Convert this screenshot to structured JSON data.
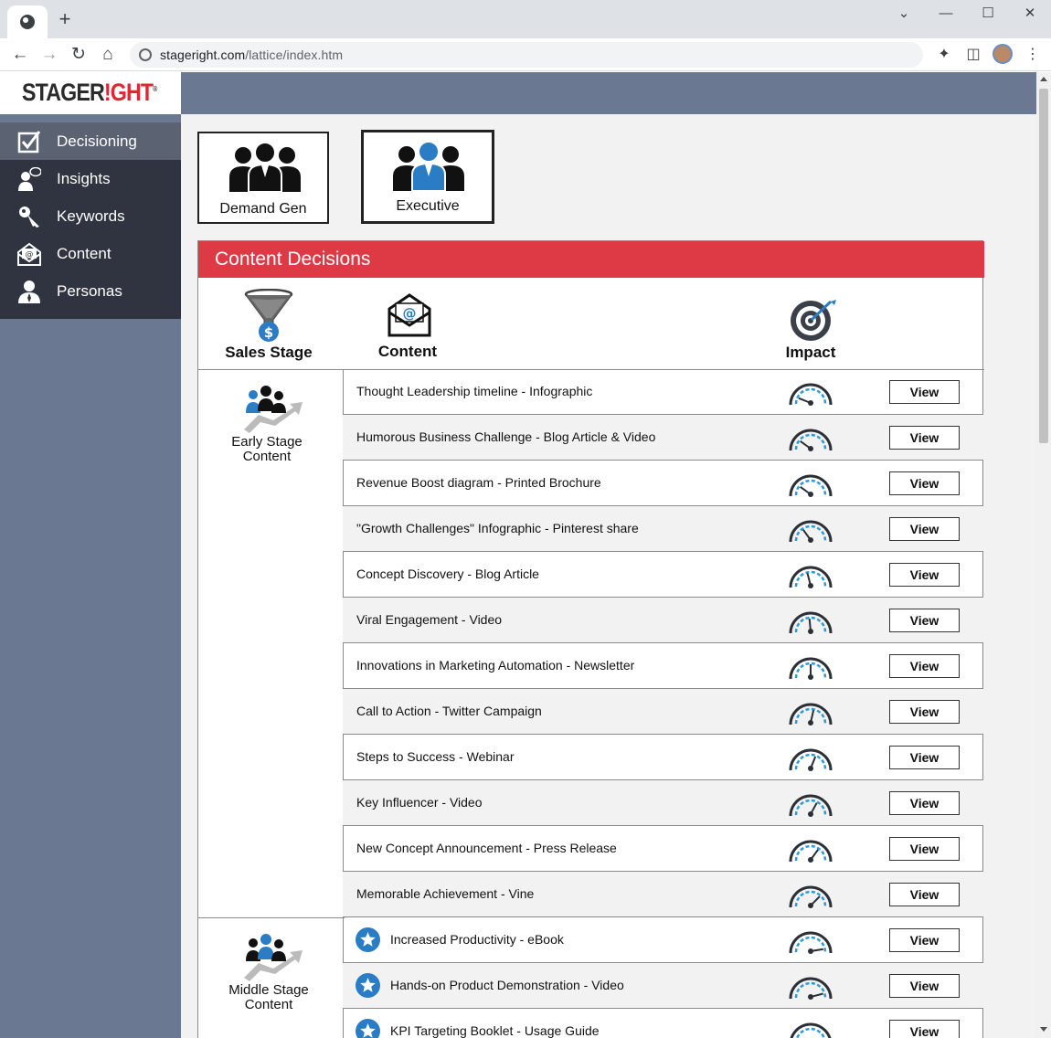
{
  "browser": {
    "url_host": "stageright.com",
    "url_path": "/lattice/index.htm"
  },
  "brand": {
    "logo_part1": "STAGER",
    "logo_part2": "!GHT",
    "logo_mark": "®"
  },
  "sidebar": {
    "items": [
      {
        "label": "Decisioning",
        "icon": "checkbox-icon",
        "active": true
      },
      {
        "label": "Insights",
        "icon": "speech-person-icon",
        "active": false
      },
      {
        "label": "Keywords",
        "icon": "key-icon",
        "active": false
      },
      {
        "label": "Content",
        "icon": "envelope-at-icon",
        "active": false
      },
      {
        "label": "Personas",
        "icon": "person-icon",
        "active": false
      }
    ]
  },
  "personas": [
    {
      "label": "Demand Gen",
      "selected": false
    },
    {
      "label": "Executive",
      "selected": true
    }
  ],
  "panel": {
    "title": "Content Decisions",
    "col_sales_stage": "Sales Stage",
    "col_content": "Content",
    "col_impact": "Impact",
    "view_label": "View"
  },
  "stages": [
    {
      "line1": "Early Stage",
      "line2": "Content"
    },
    {
      "line1": "Middle Stage",
      "line2": "Content"
    }
  ],
  "colors": {
    "accent_red": "#de3a45",
    "sidebar": "#6b7891",
    "menu_dark": "#2f3440",
    "gauge_blue": "#2a9bd8"
  },
  "rows": [
    {
      "text": "Thought Leadership timeline - Infographic",
      "impact": 0.12,
      "starred": false
    },
    {
      "text": "Humorous Business Challenge - Blog Article & Video",
      "impact": 0.2,
      "starred": false
    },
    {
      "text": "Revenue Boost diagram - Printed Brochure",
      "impact": 0.2,
      "starred": false
    },
    {
      "text": "\"Growth Challenges\" Infographic - Pinterest share",
      "impact": 0.3,
      "starred": false
    },
    {
      "text": "Concept Discovery - Blog Article",
      "impact": 0.42,
      "starred": false
    },
    {
      "text": "Viral Engagement - Video",
      "impact": 0.47,
      "starred": false
    },
    {
      "text": "Innovations in Marketing Automation - Newsletter",
      "impact": 0.5,
      "starred": false
    },
    {
      "text": "Call to Action - Twitter Campaign",
      "impact": 0.57,
      "starred": false
    },
    {
      "text": "Steps to Success - Webinar",
      "impact": 0.62,
      "starred": false
    },
    {
      "text": "Key Influencer - Video",
      "impact": 0.66,
      "starred": false
    },
    {
      "text": "New Concept Announcement - Press Release",
      "impact": 0.7,
      "starred": false
    },
    {
      "text": "Memorable Achievement - Vine",
      "impact": 0.75,
      "starred": false
    },
    {
      "text": "Increased Productivity - eBook",
      "impact": 0.95,
      "starred": true
    },
    {
      "text": "Hands-on Product Demonstration - Video",
      "impact": 0.92,
      "starred": true
    },
    {
      "text": "KPI Targeting Booklet - Usage Guide",
      "impact": 0.9,
      "starred": true
    }
  ]
}
